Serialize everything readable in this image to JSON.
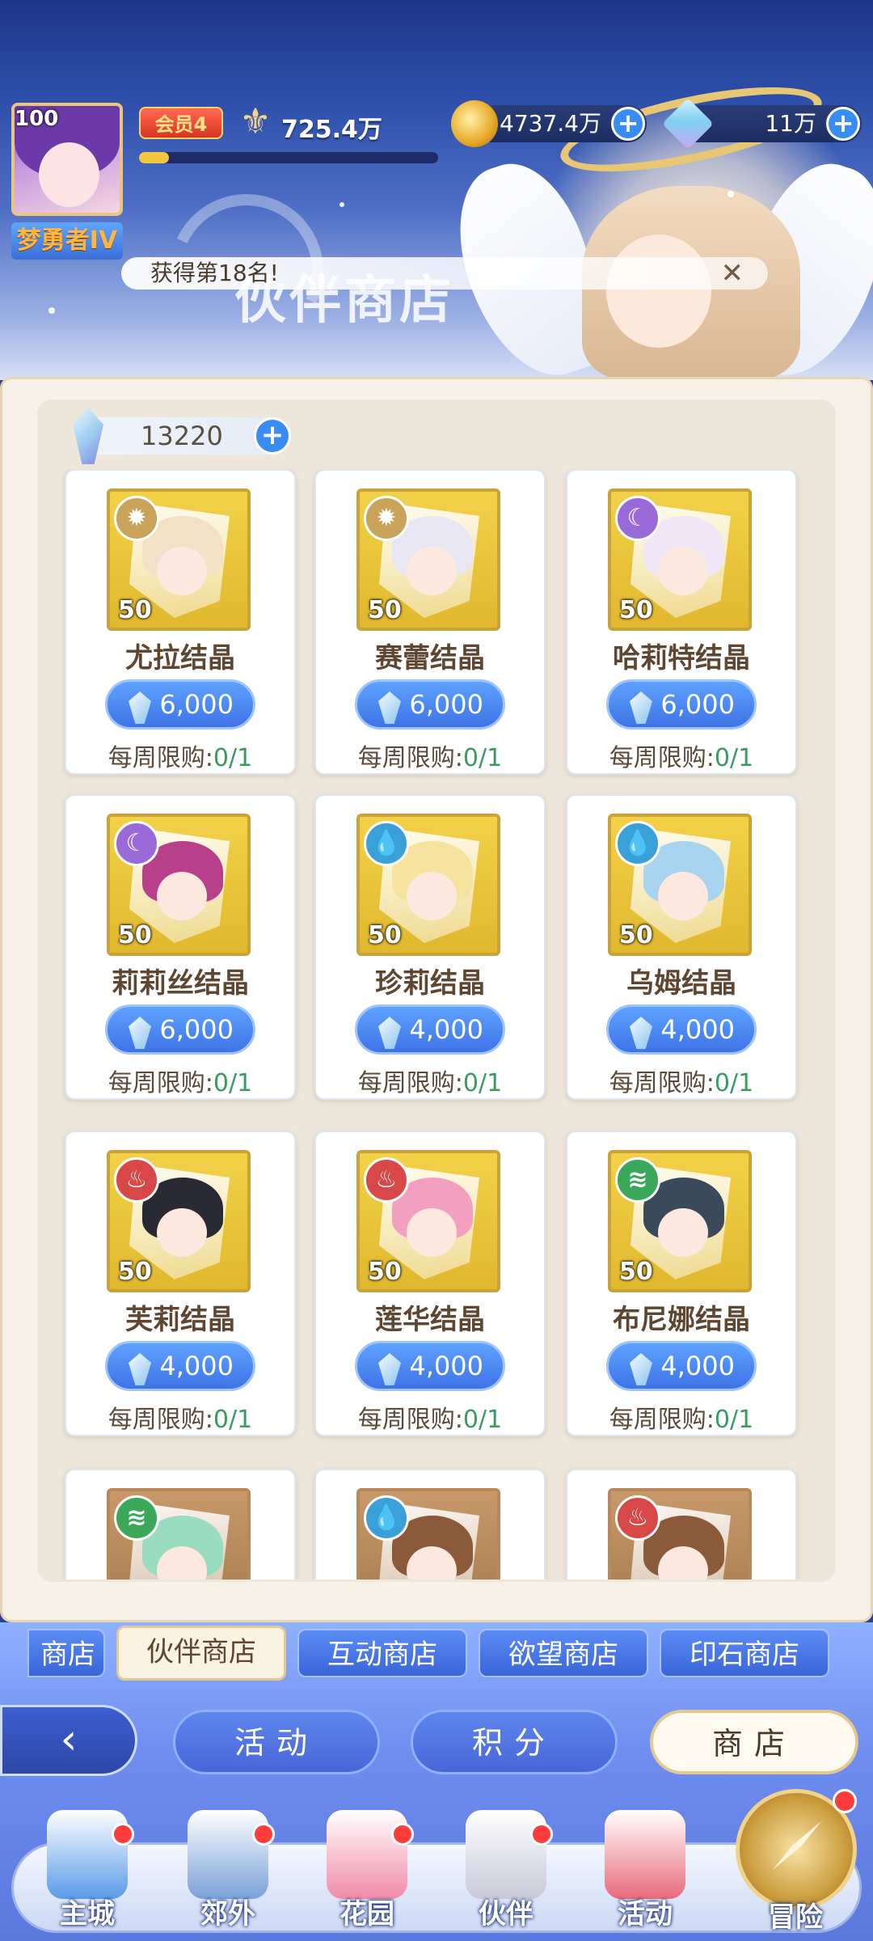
{
  "player": {
    "level": "100",
    "rank_title": "梦勇者IV",
    "vip": "会员4",
    "power": "725.4万",
    "exp_progress": 0.1
  },
  "resources": {
    "gold": "4737.4万",
    "gems": "11万"
  },
  "notice": {
    "text": "获得第18名!",
    "close": "✕"
  },
  "shop": {
    "title": "伙伴商店",
    "crystal_balance": "13220",
    "items": [
      {
        "name": "尤拉结晶",
        "price": "6,000",
        "limit_label": "每周限购:",
        "limit": "0/1",
        "level": "50",
        "element": "light",
        "elem_symbol": "✹",
        "elem_color": "#c9a35a",
        "hair": "#f3e0c6"
      },
      {
        "name": "赛蕾结晶",
        "price": "6,000",
        "limit_label": "每周限购:",
        "limit": "0/1",
        "level": "50",
        "element": "light",
        "elem_symbol": "✹",
        "elem_color": "#c9a35a",
        "hair": "#e8e6f2"
      },
      {
        "name": "哈莉特结晶",
        "price": "6,000",
        "limit_label": "每周限购:",
        "limit": "0/1",
        "level": "50",
        "element": "moon",
        "elem_symbol": "☾",
        "elem_color": "#9a6ad8",
        "hair": "#f0e6f6"
      },
      {
        "name": "莉莉丝结晶",
        "price": "6,000",
        "limit_label": "每周限购:",
        "limit": "0/1",
        "level": "50",
        "element": "moon",
        "elem_symbol": "☾",
        "elem_color": "#9a6ad8",
        "hair": "#b8408a"
      },
      {
        "name": "珍莉结晶",
        "price": "4,000",
        "limit_label": "每周限购:",
        "limit": "0/1",
        "level": "50",
        "element": "water",
        "elem_symbol": "💧",
        "elem_color": "#3aa0d8",
        "hair": "#f6e3a0"
      },
      {
        "name": "乌姆结晶",
        "price": "4,000",
        "limit_label": "每周限购:",
        "limit": "0/1",
        "level": "50",
        "element": "water",
        "elem_symbol": "💧",
        "elem_color": "#3aa0d8",
        "hair": "#a8d4f0"
      },
      {
        "name": "芙莉结晶",
        "price": "4,000",
        "limit_label": "每周限购:",
        "limit": "0/1",
        "level": "50",
        "element": "fire",
        "elem_symbol": "♨",
        "elem_color": "#d84848",
        "hair": "#2a2a34"
      },
      {
        "name": "莲华结晶",
        "price": "4,000",
        "limit_label": "每周限购:",
        "limit": "0/1",
        "level": "50",
        "element": "fire",
        "elem_symbol": "♨",
        "elem_color": "#d84848",
        "hair": "#f3a0c0"
      },
      {
        "name": "布尼娜结晶",
        "price": "4,000",
        "limit_label": "每周限购:",
        "limit": "0/1",
        "level": "50",
        "element": "wind",
        "elem_symbol": "≋",
        "elem_color": "#3aa858",
        "hair": "#3a4a5a"
      },
      {
        "name": "",
        "price": "",
        "limit_label": "",
        "limit": "",
        "level": "",
        "element": "wind",
        "elem_symbol": "≋",
        "elem_color": "#3aa858",
        "hair": "#9adcc0"
      },
      {
        "name": "",
        "price": "",
        "limit_label": "",
        "limit": "",
        "level": "",
        "element": "water",
        "elem_symbol": "💧",
        "elem_color": "#3aa0d8",
        "hair": "#8a5a3a"
      },
      {
        "name": "",
        "price": "",
        "limit_label": "",
        "limit": "",
        "level": "",
        "element": "fire",
        "elem_symbol": "♨",
        "elem_color": "#d84848",
        "hair": "#8a5a3a"
      }
    ]
  },
  "shop_tabs": [
    "商店",
    "伙伴商店",
    "互动商店",
    "欲望商店",
    "印石商店"
  ],
  "active_tab": "伙伴商店",
  "nav": {
    "back_symbol": "‹",
    "activity": "活动",
    "points": "积分",
    "shop": "商店"
  },
  "dock": [
    {
      "label": "主城",
      "color": "#5a9ae8",
      "badge": true
    },
    {
      "label": "郊外",
      "color": "#7aa0d8",
      "badge": true
    },
    {
      "label": "花园",
      "color": "#f08aa8",
      "badge": true
    },
    {
      "label": "伙伴",
      "color": "#c8c8d8",
      "badge": true
    },
    {
      "label": "活动",
      "color": "#e86a7a",
      "badge": false
    }
  ],
  "adventure": {
    "label": "冒险",
    "badge": true
  }
}
